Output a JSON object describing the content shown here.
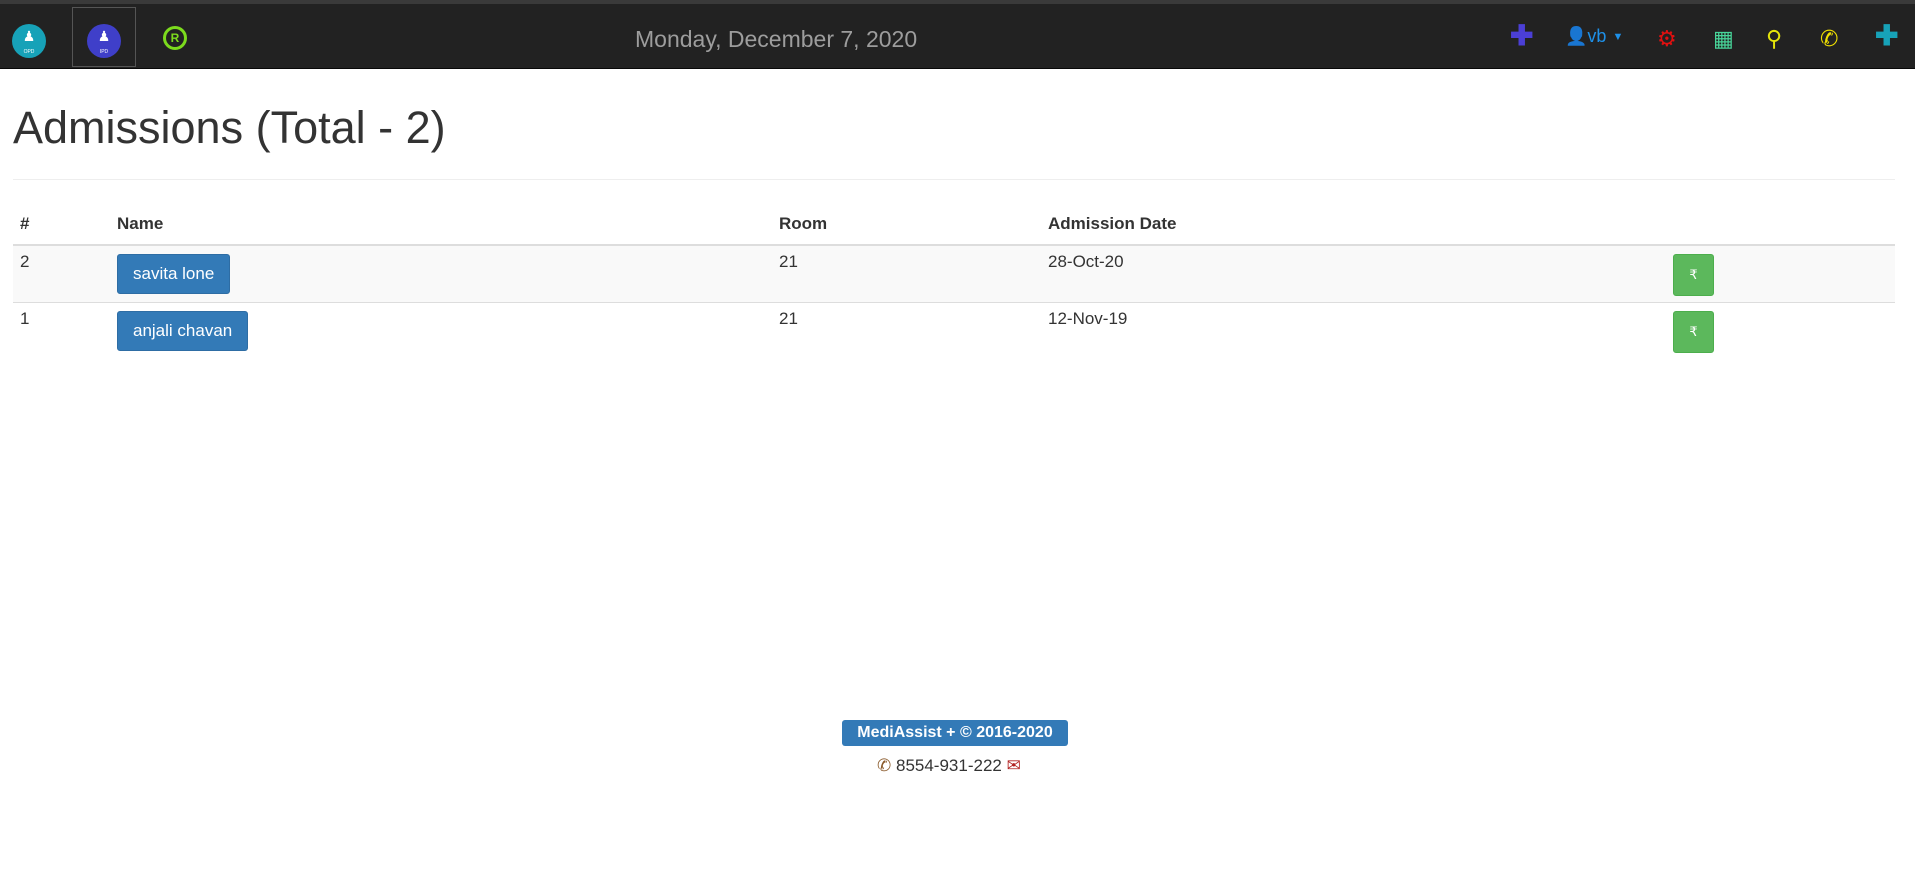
{
  "header": {
    "logos": {
      "opd_caption": "OPD",
      "ipd_caption": "IPD",
      "r_label": "R"
    },
    "date": "Monday, December 7, 2020",
    "user": {
      "name": "vb"
    },
    "icons": [
      "plus-icon",
      "user-icon",
      "gear-icon",
      "spreadsheet-icon",
      "search-icon",
      "phone-icon",
      "plus-icon"
    ],
    "colors": {
      "bar": "#222222",
      "plus_left": "#4b3fd6",
      "user": "#1e90e8",
      "gear": "#e01010",
      "sheet": "#48d59a",
      "search": "#e6e60a",
      "phone": "#f0e000",
      "plus_right": "#17a2b8"
    }
  },
  "page": {
    "title": "Admissions (Total - 2)"
  },
  "table": {
    "headers": [
      "#",
      "Name",
      "Room",
      "Admission Date",
      ""
    ],
    "rows": [
      {
        "num": "2",
        "name": "savita lone",
        "room": "21",
        "date": "28-Oct-20",
        "action": "₹"
      },
      {
        "num": "1",
        "name": "anjali chavan",
        "room": "21",
        "date": "12-Nov-19",
        "action": "₹"
      }
    ]
  },
  "footer": {
    "badge": "MediAssist + © 2016-2020",
    "phone": "8554-931-222"
  }
}
